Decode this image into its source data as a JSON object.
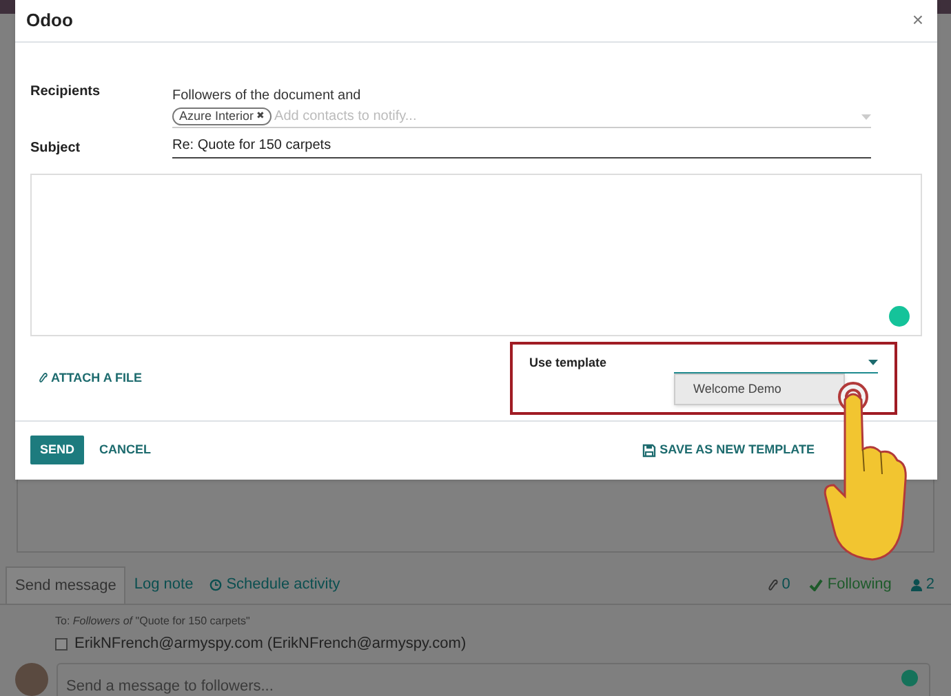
{
  "dialog": {
    "title": "Odoo",
    "close": "×",
    "recipients": {
      "label": "Recipients",
      "intro": "Followers of the document and",
      "tags": [
        {
          "label": "Azure Interior",
          "remove": "✖"
        }
      ],
      "placeholder": "Add contacts to notify..."
    },
    "subject": {
      "label": "Subject",
      "value": "Re: Quote for 150 carpets"
    },
    "attach": "ATTACH A FILE",
    "template": {
      "label": "Use template",
      "options": [
        {
          "label": "Welcome Demo",
          "selected": true
        }
      ]
    },
    "buttons": [
      {
        "label": "SEND",
        "kind": "primary"
      },
      {
        "label": "CANCEL",
        "kind": "link"
      }
    ],
    "save_template": "SAVE AS NEW TEMPLATE"
  },
  "chatter": {
    "tabs": [
      {
        "label": "Send message",
        "selected": true,
        "kind": "plain"
      },
      {
        "label": "Log note",
        "selected": false,
        "kind": "plain"
      },
      {
        "label": "Schedule activity",
        "selected": false,
        "kind": "clock"
      }
    ],
    "attachments": "0",
    "following": "Following",
    "followers": "2",
    "to_prefix": "To:",
    "to_followers": "Followers of",
    "to_record": "\"Quote for 150 carpets\"",
    "recipients": [
      {
        "label": "ErikNFrench@armyspy.com (ErikNFrench@armyspy.com)",
        "checked": false
      }
    ],
    "placeholder": "Send a message to followers..."
  }
}
